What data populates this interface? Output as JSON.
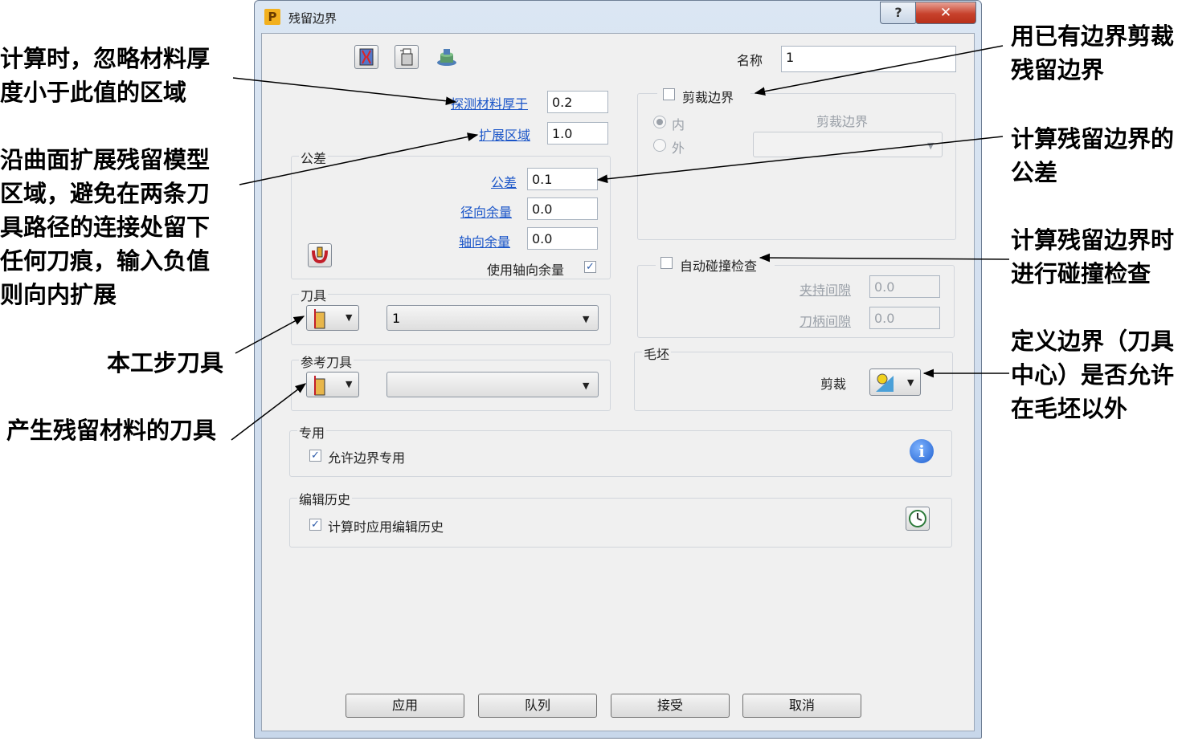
{
  "window": {
    "title": "残留边界",
    "app_icon": "P",
    "help_glyph": "?",
    "close_glyph": "✕"
  },
  "name_field": {
    "label": "名称",
    "value": "1"
  },
  "detect_thickness": {
    "label": "探测材料厚于",
    "value": "0.2"
  },
  "expand_area": {
    "label": "扩展区域",
    "value": "1.0"
  },
  "tolerance_group": {
    "title": "公差",
    "tolerance": {
      "label": "公差",
      "value": "0.1"
    },
    "radial_offset": {
      "label": "径向余量",
      "value": "0.0"
    },
    "axial_offset": {
      "label": "轴向余量",
      "value": "0.0"
    },
    "use_axial": {
      "label": "使用轴向余量",
      "checked": true
    }
  },
  "tool_group": {
    "title": "刀具",
    "selected": "1"
  },
  "ref_tool_group": {
    "title": "参考刀具",
    "selected": ""
  },
  "special_group": {
    "title": "专用",
    "checkbox_label": "允许边界专用",
    "checked": true,
    "info_glyph": "i"
  },
  "history_group": {
    "title": "编辑历史",
    "checkbox_label": "计算时应用编辑历史",
    "checked": true
  },
  "trim_group": {
    "checkbox_label": "剪裁边界",
    "checked": false,
    "boundary_label": "剪裁边界",
    "radio_inside": "内",
    "radio_outside": "外",
    "selected_radio": "inside"
  },
  "collision_group": {
    "checkbox_label": "自动碰撞检查",
    "checked": false,
    "holder_clearance": {
      "label": "夹持间隙",
      "value": "0.0"
    },
    "shank_clearance": {
      "label": "刀柄间隙",
      "value": "0.0"
    }
  },
  "stock_group": {
    "title": "毛坯",
    "trim_label": "剪裁"
  },
  "buttons": {
    "apply": "应用",
    "queue": "队列",
    "accept": "接受",
    "cancel": "取消"
  },
  "toolbar_icons": [
    "boundary-tool-icon",
    "tool-holder-icon",
    "stock-model-icon"
  ],
  "annotations": {
    "a1": [
      "计算时，忽略材料厚",
      "度小于此值的区域"
    ],
    "a2": [
      "沿曲面扩展残留模型",
      "区域，避免在两条刀",
      "具路径的连接处留下",
      "任何刀痕，输入负值",
      "则向内扩展"
    ],
    "a3": "本工步刀具",
    "a4": "产生残留材料的刀具",
    "a5": [
      "用已有边界剪裁",
      "残留边界"
    ],
    "a6": [
      "计算残留边界的",
      "公差"
    ],
    "a7": [
      "计算残留边界时",
      "进行碰撞检查"
    ],
    "a8": [
      "定义边界（刀具",
      "中心）是否允许",
      "在毛坯以外"
    ]
  },
  "colors": {
    "link": "#1a55c8",
    "disabled": "#9aa0a8",
    "close_button": "#c7412c",
    "window_frame": "#c8d7ea"
  }
}
